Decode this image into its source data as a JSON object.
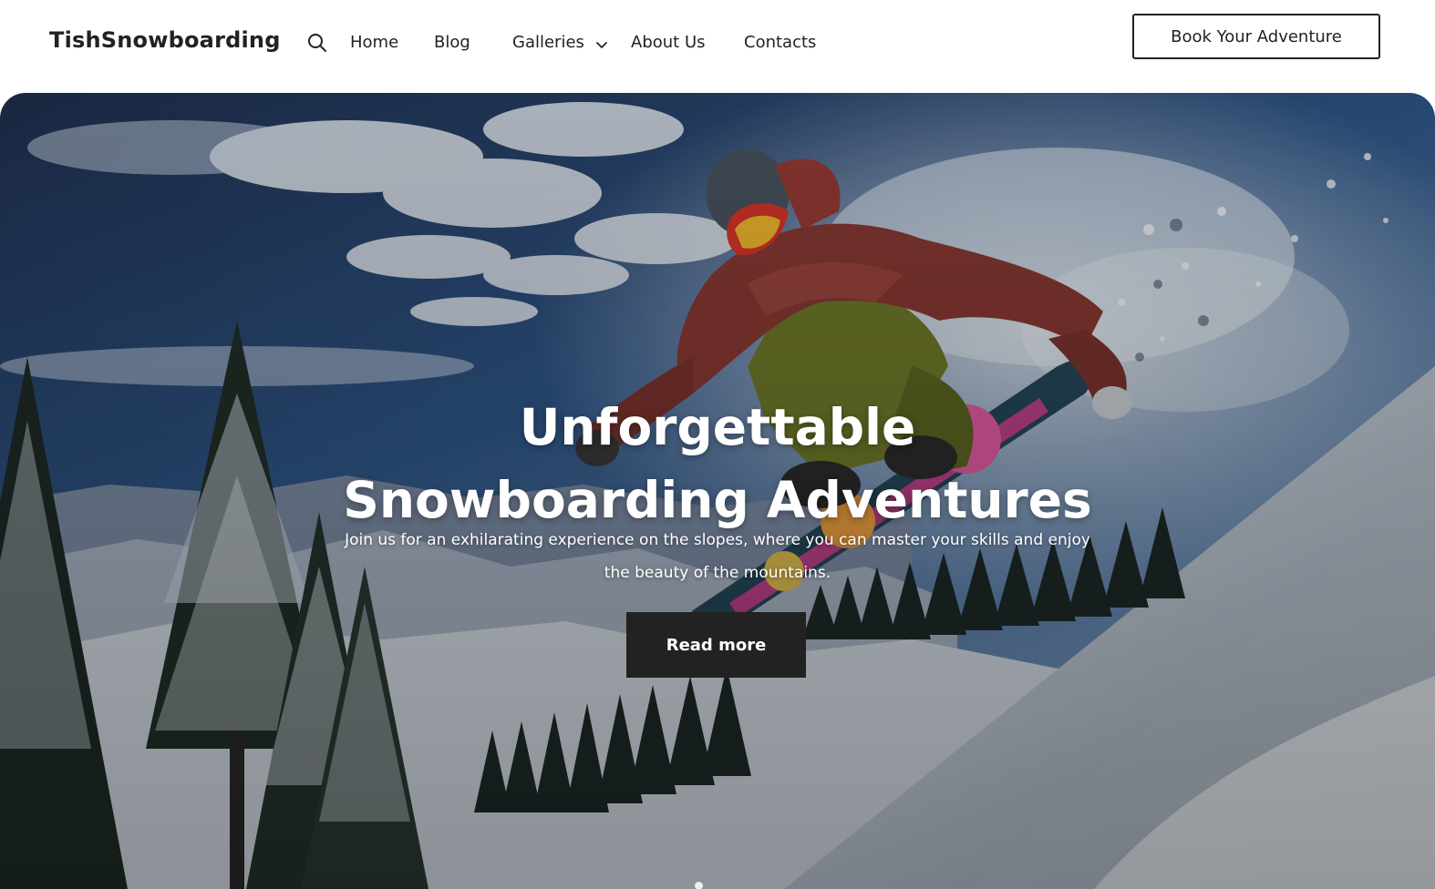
{
  "header": {
    "logo": "TishSnowboarding",
    "search_icon": "search-icon",
    "nav": {
      "home": "Home",
      "blog": "Blog",
      "galleries": "Galleries",
      "about": "About Us",
      "contacts": "Contacts"
    },
    "cta_label": "Book Your Adventure"
  },
  "hero": {
    "title_line1": "Unforgettable",
    "title_line2": "Snowboarding Adventures",
    "subtitle": "Join us for an exhilarating experience on the slopes, where you can master your skills and enjoy the beauty of the mountains.",
    "button_label": "Read more",
    "image": "snowboarder-jumping-on-mountain-slope"
  },
  "colors": {
    "text": "#222222",
    "button_dark": "#222222",
    "sky": "#2c4d7a",
    "snow": "#e7ecf2"
  }
}
